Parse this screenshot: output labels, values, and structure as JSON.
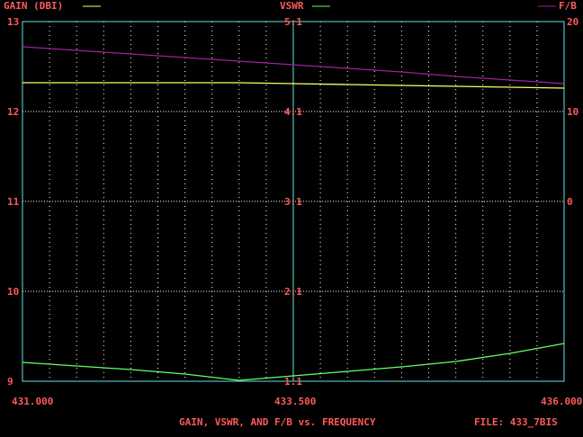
{
  "chart_data": {
    "type": "line",
    "title": "GAIN, VSWR, AND F/B vs. FREQUENCY",
    "file_label": "FILE: 433_7BIS",
    "x": [
      431.0,
      431.5,
      432.0,
      432.5,
      433.0,
      433.5,
      434.0,
      434.5,
      435.0,
      435.5,
      436.0
    ],
    "xlim": [
      431.0,
      436.0
    ],
    "x_ticks": [
      "431.000",
      "433.500",
      "436.000"
    ],
    "grid": true,
    "axes": {
      "gain": {
        "label": "GAIN (DBI)",
        "ylim": [
          9,
          13
        ],
        "ticks": [
          "13",
          "12",
          "11",
          "10",
          "9"
        ]
      },
      "vswr": {
        "label": "VSWR",
        "ylim": [
          1,
          5
        ],
        "ticks": [
          "5:1",
          "4:1",
          "3:1",
          "2:1",
          "1:1"
        ]
      },
      "fb": {
        "label": "F/B",
        "ylim": [
          -20,
          20
        ],
        "ticks": [
          "20",
          "10",
          "0"
        ]
      }
    },
    "series": [
      {
        "name": "GAIN (DBI)",
        "axis": "gain",
        "color": "#ffff66",
        "values": [
          12.32,
          12.32,
          12.32,
          12.32,
          12.32,
          12.31,
          12.3,
          12.29,
          12.28,
          12.27,
          12.26
        ]
      },
      {
        "name": "VSWR",
        "axis": "vswr",
        "color": "#66ff66",
        "values": [
          1.21,
          1.17,
          1.13,
          1.08,
          1.01,
          1.06,
          1.11,
          1.16,
          1.22,
          1.31,
          1.42
        ]
      },
      {
        "name": "F/B",
        "axis": "fb",
        "color": "#a020a0",
        "values": [
          17.2,
          16.8,
          16.4,
          16.0,
          15.6,
          15.2,
          14.8,
          14.4,
          13.9,
          13.5,
          13.1
        ]
      }
    ],
    "colors": {
      "text": "#ff5a5a",
      "frame": "#66e0e0",
      "grid": "#ffffff"
    }
  }
}
